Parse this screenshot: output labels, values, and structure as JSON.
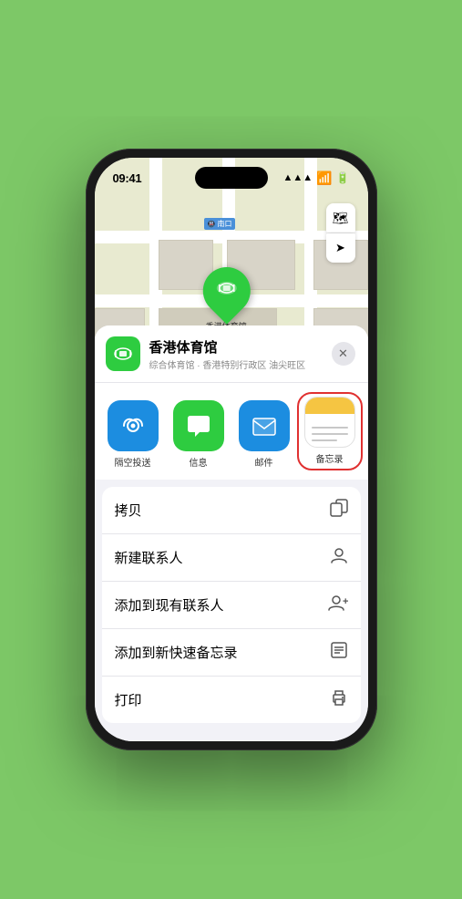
{
  "status": {
    "time": "09:41",
    "signal": "▲",
    "wifi": "WiFi",
    "battery": "Battery"
  },
  "map": {
    "pin_label": "香港体育馆",
    "station_label": "南口",
    "layer_icon": "🗺",
    "location_icon": "➤"
  },
  "location_card": {
    "name": "香港体育馆",
    "sub": "综合体育馆 · 香港特别行政区 油尖旺区",
    "close_label": "×"
  },
  "share_apps": [
    {
      "id": "airdrop",
      "label": "隔空投送",
      "type": "airdrop"
    },
    {
      "id": "messages",
      "label": "信息",
      "type": "messages"
    },
    {
      "id": "mail",
      "label": "邮件",
      "type": "mail"
    },
    {
      "id": "notes",
      "label": "备忘录",
      "type": "notes"
    }
  ],
  "more_dots_colors": [
    "#f00",
    "#fa0",
    "#0c0"
  ],
  "actions": [
    {
      "id": "copy",
      "label": "拷贝",
      "icon": "⎘"
    },
    {
      "id": "new-contact",
      "label": "新建联系人",
      "icon": "👤"
    },
    {
      "id": "add-contact",
      "label": "添加到现有联系人",
      "icon": "👤"
    },
    {
      "id": "quick-note",
      "label": "添加到新快速备忘录",
      "icon": "📋"
    },
    {
      "id": "print",
      "label": "打印",
      "icon": "🖨"
    }
  ]
}
